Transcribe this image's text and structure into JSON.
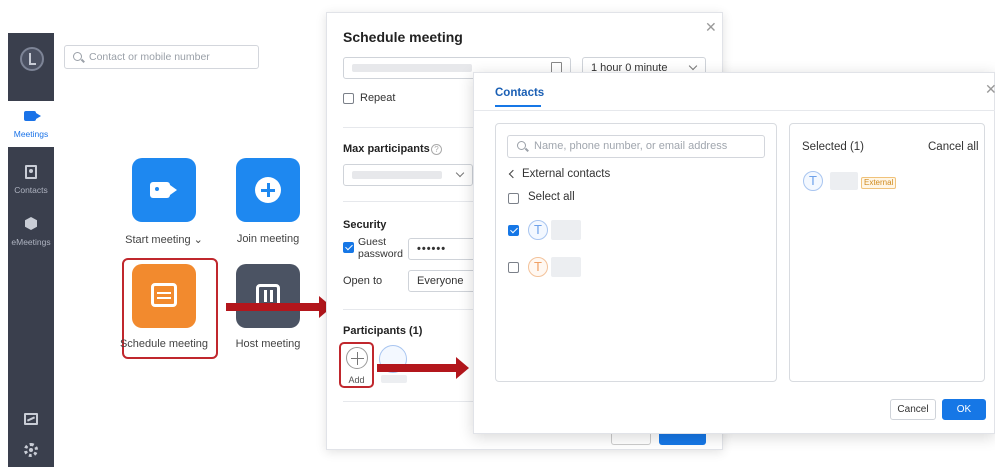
{
  "app": {
    "search_placeholder": "Contact or mobile number",
    "nav": {
      "meetings": "Meetings",
      "contacts": "Contacts",
      "emeetings": "eMeetings"
    },
    "tiles": {
      "start": "Start meeting",
      "join": "Join meeting",
      "schedule": "Schedule meeting",
      "host": "Host meeting"
    },
    "icons": [
      "logo-icon",
      "video-camera-icon",
      "contact-card-icon",
      "cube-icon",
      "chart-icon",
      "settings-icon",
      "plus-icon",
      "calendar-icon",
      "host-icon"
    ]
  },
  "schedule_dialog": {
    "title": "Schedule meeting",
    "duration": "1 hour 0 minute",
    "repeat_label": "Repeat",
    "max_participants_label": "Max participants",
    "security_label": "Security",
    "guest_password_label_1": "Guest",
    "guest_password_label_2": "password",
    "guest_password_value": "••••••",
    "open_to_label": "Open to",
    "open_to_value": "Everyone",
    "participants_label": "Participants (1)",
    "add_label": "Add"
  },
  "contacts_dialog": {
    "title": "Contacts",
    "search_placeholder": "Name, phone number, or email address",
    "external_contacts": "External contacts",
    "select_all": "Select all",
    "contact_initial": "T",
    "selected_label": "Selected (1)",
    "cancel_all": "Cancel all",
    "external_badge": "External",
    "cancel_button": "Cancel",
    "ok_button": "OK"
  },
  "colors": {
    "accent": "#1677e6",
    "highlight": "#c0272d",
    "sidebar": "#3a3f4d",
    "schedule_tile": "#f28a2e",
    "host_tile": "#4b5363"
  }
}
